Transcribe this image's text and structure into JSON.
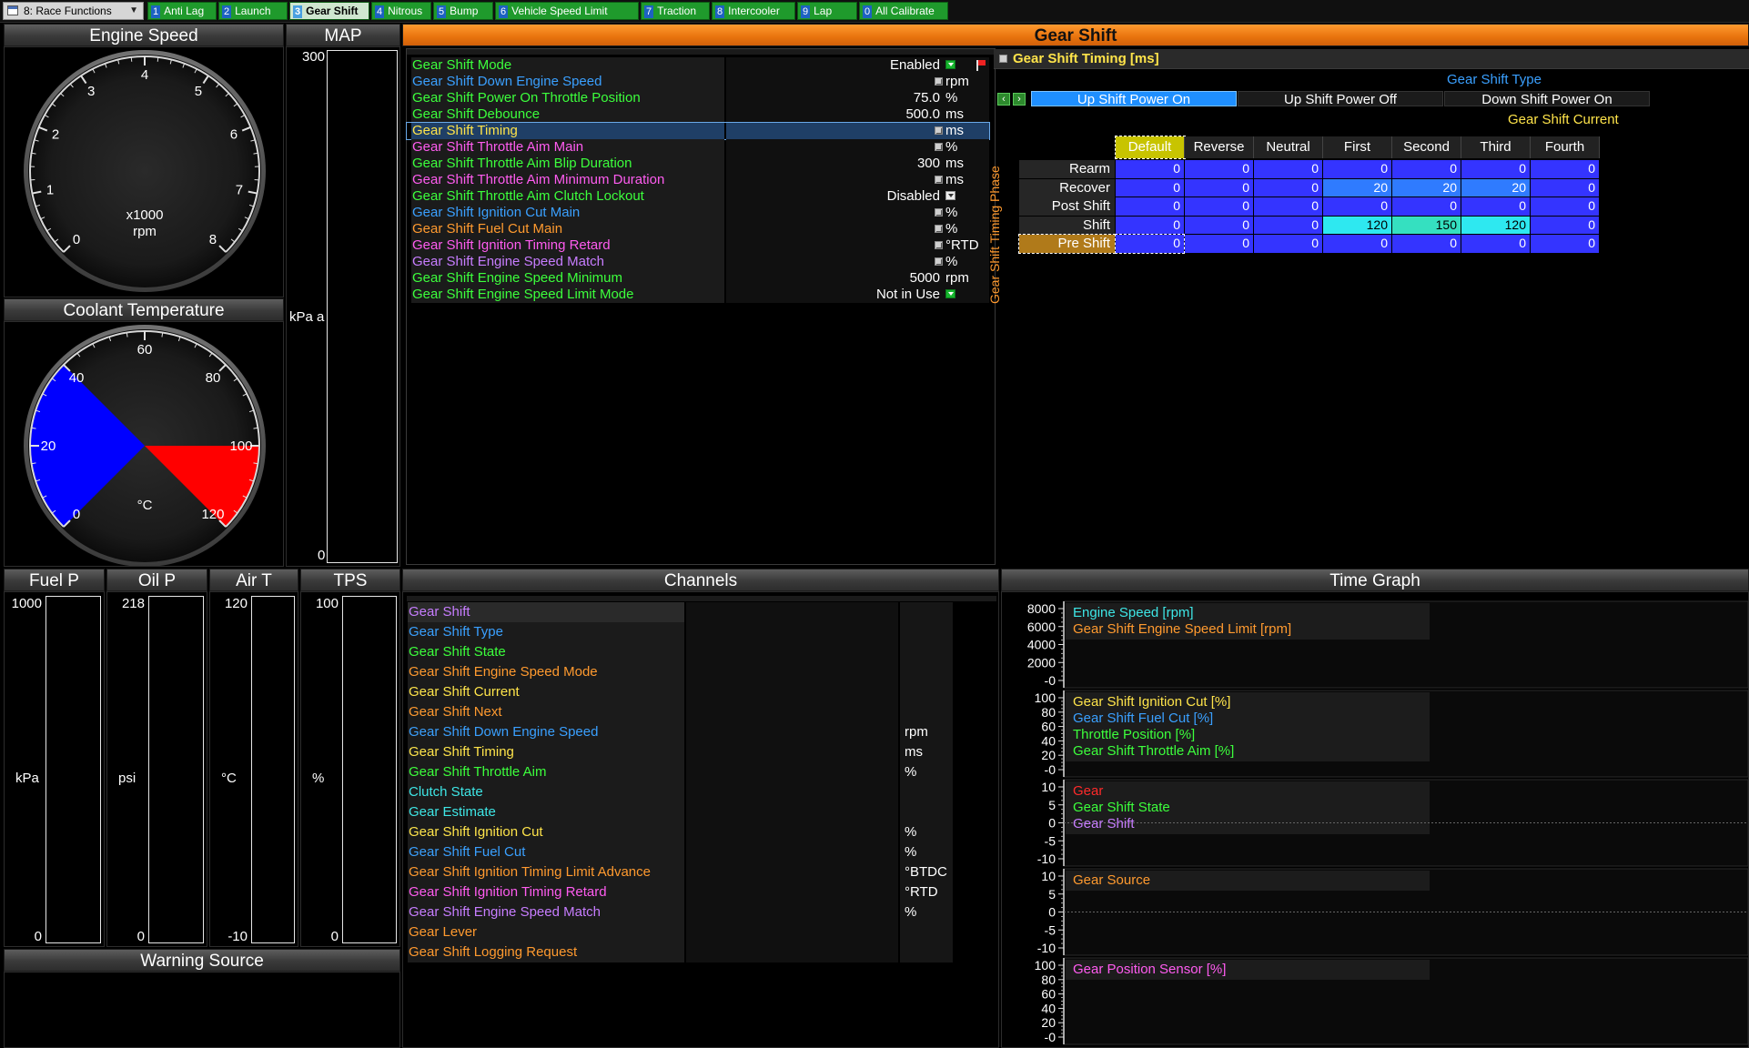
{
  "topbar": {
    "layout_select": "8: Race Functions",
    "tabs": [
      {
        "num": "1",
        "label": "Anti Lag"
      },
      {
        "num": "2",
        "label": "Launch"
      },
      {
        "num": "3",
        "label": "Gear Shift"
      },
      {
        "num": "4",
        "label": "Nitrous"
      },
      {
        "num": "5",
        "label": "Bump"
      },
      {
        "num": "6",
        "label": "Vehicle Speed Limit"
      },
      {
        "num": "7",
        "label": "Traction"
      },
      {
        "num": "8",
        "label": "Intercooler"
      },
      {
        "num": "9",
        "label": "Lap"
      },
      {
        "num": "0",
        "label": "All Calibrate"
      }
    ],
    "active_tab": 2
  },
  "engine_speed": {
    "title": "Engine Speed",
    "scale": "x1000",
    "unit": "rpm",
    "ticks": [
      "0",
      "1",
      "2",
      "3",
      "4",
      "5",
      "6",
      "7",
      "8"
    ]
  },
  "coolant": {
    "title": "Coolant Temperature",
    "unit": "°C",
    "ticks": [
      "0",
      "20",
      "40",
      "60",
      "80",
      "100",
      "120"
    ],
    "cold_color": "#0000ff",
    "hot_color": "#ff0000"
  },
  "map_gauge": {
    "title": "MAP",
    "max": "300",
    "min": "0",
    "unit": "kPa a"
  },
  "bar_gauges": [
    {
      "title": "Fuel P",
      "max": "1000",
      "min": "0",
      "unit": "kPa"
    },
    {
      "title": "Oil P",
      "max": "218",
      "min": "0",
      "unit": "psi"
    },
    {
      "title": "Air T",
      "max": "120",
      "min": "-10",
      "unit": "°C"
    },
    {
      "title": "TPS",
      "max": "100",
      "min": "0",
      "unit": "%"
    }
  ],
  "warning_source": {
    "title": "Warning Source"
  },
  "gear_shift_panel": {
    "title": "Gear Shift"
  },
  "settings": [
    {
      "name": "Gear Shift Mode",
      "color": "#3cff3c",
      "value": "Enabled",
      "unit": "",
      "kind": "dropdown",
      "flag": true
    },
    {
      "name": "Gear Shift Down Engine Speed",
      "color": "#3aa0ff",
      "value": "",
      "unit": "rpm",
      "kind": "table"
    },
    {
      "name": "Gear Shift Power On Throttle Position",
      "color": "#3cff3c",
      "value": "75.0",
      "unit": "%",
      "kind": "value"
    },
    {
      "name": "Gear Shift Debounce",
      "color": "#3cff3c",
      "value": "500.0",
      "unit": "ms",
      "kind": "value"
    },
    {
      "name": "Gear Shift Timing",
      "color": "#ffe44a",
      "value": "",
      "unit": "ms",
      "kind": "table",
      "selected": true
    },
    {
      "name": "Gear Shift Throttle Aim Main",
      "color": "#ff5cf0",
      "value": "",
      "unit": "%",
      "kind": "table"
    },
    {
      "name": "Gear Shift Throttle Aim Blip Duration",
      "color": "#3cff3c",
      "value": "300",
      "unit": "ms",
      "kind": "value"
    },
    {
      "name": "Gear Shift Throttle Aim Minimum Duration",
      "color": "#ff5cf0",
      "value": "",
      "unit": "ms",
      "kind": "table"
    },
    {
      "name": "Gear Shift Throttle Aim Clutch Lockout",
      "color": "#3cff3c",
      "value": "Disabled",
      "unit": "",
      "kind": "dropdown-white"
    },
    {
      "name": "Gear Shift Ignition Cut Main",
      "color": "#3aa0ff",
      "value": "",
      "unit": "%",
      "kind": "table"
    },
    {
      "name": "Gear Shift Fuel Cut Main",
      "color": "#ff9a2f",
      "value": "",
      "unit": "%",
      "kind": "table"
    },
    {
      "name": "Gear Shift Ignition Timing Retard",
      "color": "#ff5cf0",
      "value": "",
      "unit": "°RTD",
      "kind": "table"
    },
    {
      "name": "Gear Shift Engine Speed Match",
      "color": "#c77dff",
      "value": "",
      "unit": "%",
      "kind": "table"
    },
    {
      "name": "Gear Shift Engine Speed Minimum",
      "color": "#3cff3c",
      "value": "5000",
      "unit": "rpm",
      "kind": "value"
    },
    {
      "name": "Gear Shift Engine Speed Limit Mode",
      "color": "#3cff3c",
      "value": "Not in Use",
      "unit": "",
      "kind": "dropdown"
    }
  ],
  "timing_table": {
    "title": "Gear Shift Timing [ms]",
    "axis_top_label": "Gear Shift Type",
    "phases": [
      "Up Shift Power On",
      "Up Shift Power Off",
      "Down Shift Power On"
    ],
    "axis_col_label": "Gear Shift Current",
    "axis_row_label": "Gear Shift Timing Phase",
    "columns": [
      "Default",
      "Reverse",
      "Neutral",
      "First",
      "Second",
      "Third",
      "Fourth"
    ],
    "rows": [
      {
        "label": "Rearm",
        "values": [
          "0",
          "0",
          "0",
          "0",
          "0",
          "0",
          "0"
        ]
      },
      {
        "label": "Recover",
        "values": [
          "0",
          "0",
          "0",
          "20",
          "20",
          "20",
          "0"
        ]
      },
      {
        "label": "Post Shift",
        "values": [
          "0",
          "0",
          "0",
          "0",
          "0",
          "0",
          "0"
        ]
      },
      {
        "label": "Shift",
        "values": [
          "0",
          "0",
          "0",
          "120",
          "150",
          "120",
          "0"
        ]
      },
      {
        "label": "Pre Shift",
        "values": [
          "0",
          "0",
          "0",
          "0",
          "0",
          "0",
          "0"
        ]
      }
    ]
  },
  "channels_panel": {
    "title": "Channels"
  },
  "channels": [
    {
      "name": "Gear Shift",
      "color": "#c77dff",
      "unit": ""
    },
    {
      "name": "Gear Shift Type",
      "color": "#3aa0ff",
      "unit": ""
    },
    {
      "name": "Gear Shift State",
      "color": "#3cff3c",
      "unit": ""
    },
    {
      "name": "Gear Shift Engine Speed Mode",
      "color": "#ff9a2f",
      "unit": ""
    },
    {
      "name": "Gear Shift Current",
      "color": "#ffe44a",
      "unit": ""
    },
    {
      "name": "Gear Shift Next",
      "color": "#ff9a2f",
      "unit": ""
    },
    {
      "name": "Gear Shift Down Engine Speed",
      "color": "#3aa0ff",
      "unit": "rpm"
    },
    {
      "name": "Gear Shift Timing",
      "color": "#ffe44a",
      "unit": "ms"
    },
    {
      "name": "Gear Shift Throttle Aim",
      "color": "#3cff3c",
      "unit": "%"
    },
    {
      "name": "Clutch State",
      "color": "#3ee6e6",
      "unit": ""
    },
    {
      "name": "Gear Estimate",
      "color": "#3ee6e6",
      "unit": ""
    },
    {
      "name": "Gear Shift Ignition Cut",
      "color": "#ffe44a",
      "unit": "%"
    },
    {
      "name": "Gear Shift Fuel Cut",
      "color": "#3aa0ff",
      "unit": "%"
    },
    {
      "name": "Gear Shift Ignition Timing Limit Advance",
      "color": "#ff9a2f",
      "unit": "°BTDC"
    },
    {
      "name": "Gear Shift Ignition Timing Retard",
      "color": "#ff5cf0",
      "unit": "°RTD"
    },
    {
      "name": "Gear Shift Engine Speed Match",
      "color": "#c77dff",
      "unit": "%"
    },
    {
      "name": "Gear Lever",
      "color": "#ff9a2f",
      "unit": ""
    },
    {
      "name": "Gear Shift Logging Request",
      "color": "#ff9a2f",
      "unit": ""
    }
  ],
  "time_graph": {
    "title": "Time Graph",
    "panes": [
      {
        "ticks": [
          "8000",
          "6000",
          "4000",
          "2000",
          "-0"
        ],
        "legend": [
          {
            "text": "Engine Speed [rpm]",
            "color": "#3ee6e6"
          },
          {
            "text": "Gear Shift Engine Speed Limit [rpm]",
            "color": "#ff9a2f"
          }
        ]
      },
      {
        "ticks": [
          "100",
          "80",
          "60",
          "40",
          "20",
          "-0"
        ],
        "legend": [
          {
            "text": "Gear Shift Ignition Cut [%]",
            "color": "#ffe44a"
          },
          {
            "text": "Gear Shift Fuel Cut [%]",
            "color": "#3aa0ff"
          },
          {
            "text": "Throttle Position [%]",
            "color": "#3cff3c"
          },
          {
            "text": "Gear Shift Throttle Aim [%]",
            "color": "#3cff3c"
          }
        ]
      },
      {
        "ticks": [
          "10",
          "5",
          "0",
          "-5",
          "-10"
        ],
        "legend": [
          {
            "text": "Gear",
            "color": "#ff2a2a"
          },
          {
            "text": "Gear Shift State",
            "color": "#3cff3c"
          },
          {
            "text": "Gear Shift",
            "color": "#c77dff"
          }
        ]
      },
      {
        "ticks": [
          "10",
          "5",
          "0",
          "-5",
          "-10"
        ],
        "legend": [
          {
            "text": "Gear Source",
            "color": "#ff9a2f"
          }
        ]
      },
      {
        "ticks": [
          "100",
          "80",
          "60",
          "40",
          "20",
          "-0"
        ],
        "legend": [
          {
            "text": "Gear Position Sensor [%]",
            "color": "#ff5cf0"
          }
        ]
      }
    ]
  }
}
